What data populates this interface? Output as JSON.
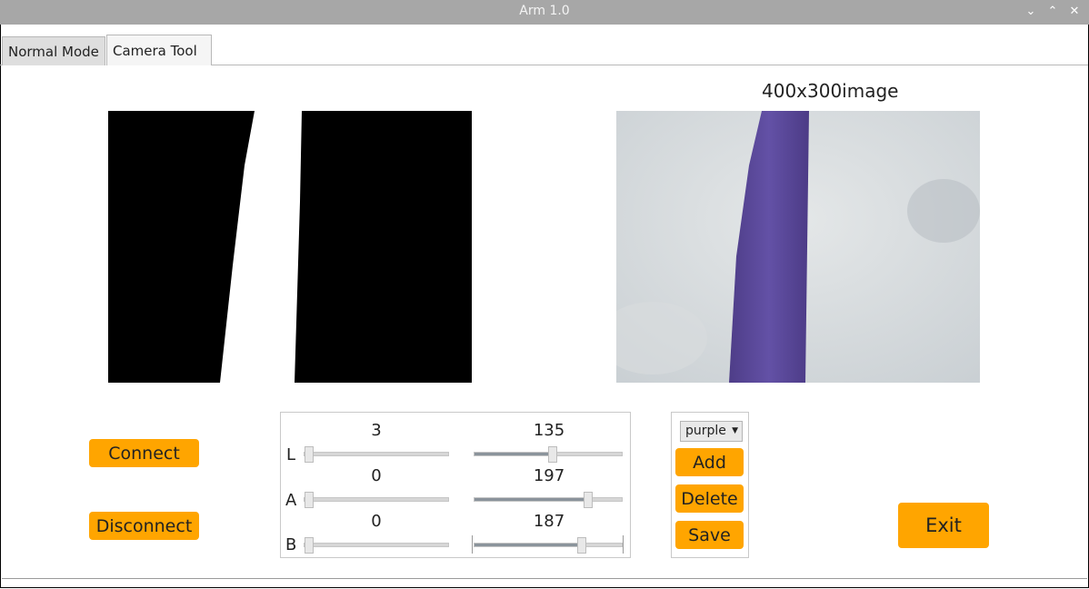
{
  "window": {
    "title": "Arm 1.0",
    "controls": [
      "minimize-icon",
      "maximize-icon",
      "close-icon"
    ]
  },
  "tabs": [
    {
      "label": "Normal Mode"
    },
    {
      "label": "Camera Tool"
    }
  ],
  "preview": {
    "caption": "400x300image"
  },
  "connection": {
    "connect_label": "Connect",
    "disconnect_label": "Disconnect"
  },
  "sliders": {
    "L": {
      "label": "L",
      "min_value": "3",
      "max_value": "135",
      "min_fraction": 0.012,
      "max_fraction": 0.53
    },
    "A": {
      "label": "A",
      "min_value": "0",
      "max_value": "197",
      "min_fraction": 0.0,
      "max_fraction": 0.77
    },
    "B": {
      "label": "B",
      "min_value": "0",
      "max_value": "187",
      "min_fraction": 0.0,
      "max_fraction": 0.73
    }
  },
  "color_panel": {
    "selected_color": "purple",
    "add_label": "Add",
    "delete_label": "Delete",
    "save_label": "Save"
  },
  "exit_label": "Exit",
  "colors": {
    "accent": "#ffa500",
    "stripe": "#5b4a99"
  }
}
